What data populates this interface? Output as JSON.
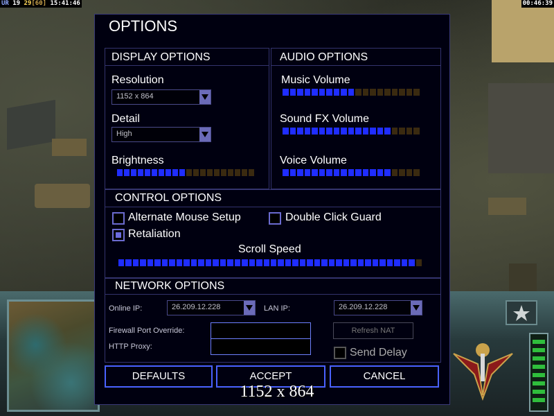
{
  "hud": {
    "left_prefix": "UR",
    "left_a": "19",
    "left_b": "29",
    "left_c": "[60]",
    "left_time": "15:41:46",
    "right_time": "00:46:39"
  },
  "options": {
    "title": "OPTIONS",
    "display": {
      "title": "DISPLAY OPTIONS",
      "resolution_label": "Resolution",
      "resolution_value": "1152 x 864",
      "detail_label": "Detail",
      "detail_value": "High",
      "brightness_label": "Brightness",
      "brightness_level": 0.5
    },
    "audio": {
      "title": "AUDIO OPTIONS",
      "music_label": "Music Volume",
      "music_level": 0.55,
      "sfx_label": "Sound FX Volume",
      "sfx_level": 0.8,
      "voice_label": "Voice Volume",
      "voice_level": 0.8
    },
    "control": {
      "title": "CONTROL OPTIONS",
      "alt_mouse_label": "Alternate Mouse Setup",
      "alt_mouse_checked": false,
      "double_click_label": "Double Click Guard",
      "double_click_checked": false,
      "retaliation_label": "Retaliation",
      "retaliation_checked": true,
      "scroll_label": "Scroll Speed",
      "scroll_level": 0.97
    },
    "network": {
      "title": "NETWORK OPTIONS",
      "online_ip_label": "Online IP:",
      "online_ip_value": "26.209.12.228",
      "lan_ip_label": "LAN IP:",
      "lan_ip_value": "26.209.12.228",
      "firewall_label": "Firewall Port Override:",
      "firewall_value": "",
      "proxy_label": "HTTP Proxy:",
      "proxy_value": "",
      "refresh_nat_label": "Refresh NAT",
      "send_delay_label": "Send Delay",
      "send_delay_checked": false
    },
    "buttons": {
      "defaults": "DEFAULTS",
      "accept": "ACCEPT",
      "cancel": "CANCEL"
    }
  },
  "overlay_resolution_text": "1152 x 864",
  "colors": {
    "slider_on": "#1f2dff",
    "slider_off": "#3a2a10",
    "accent_border": "#4a62ff"
  }
}
